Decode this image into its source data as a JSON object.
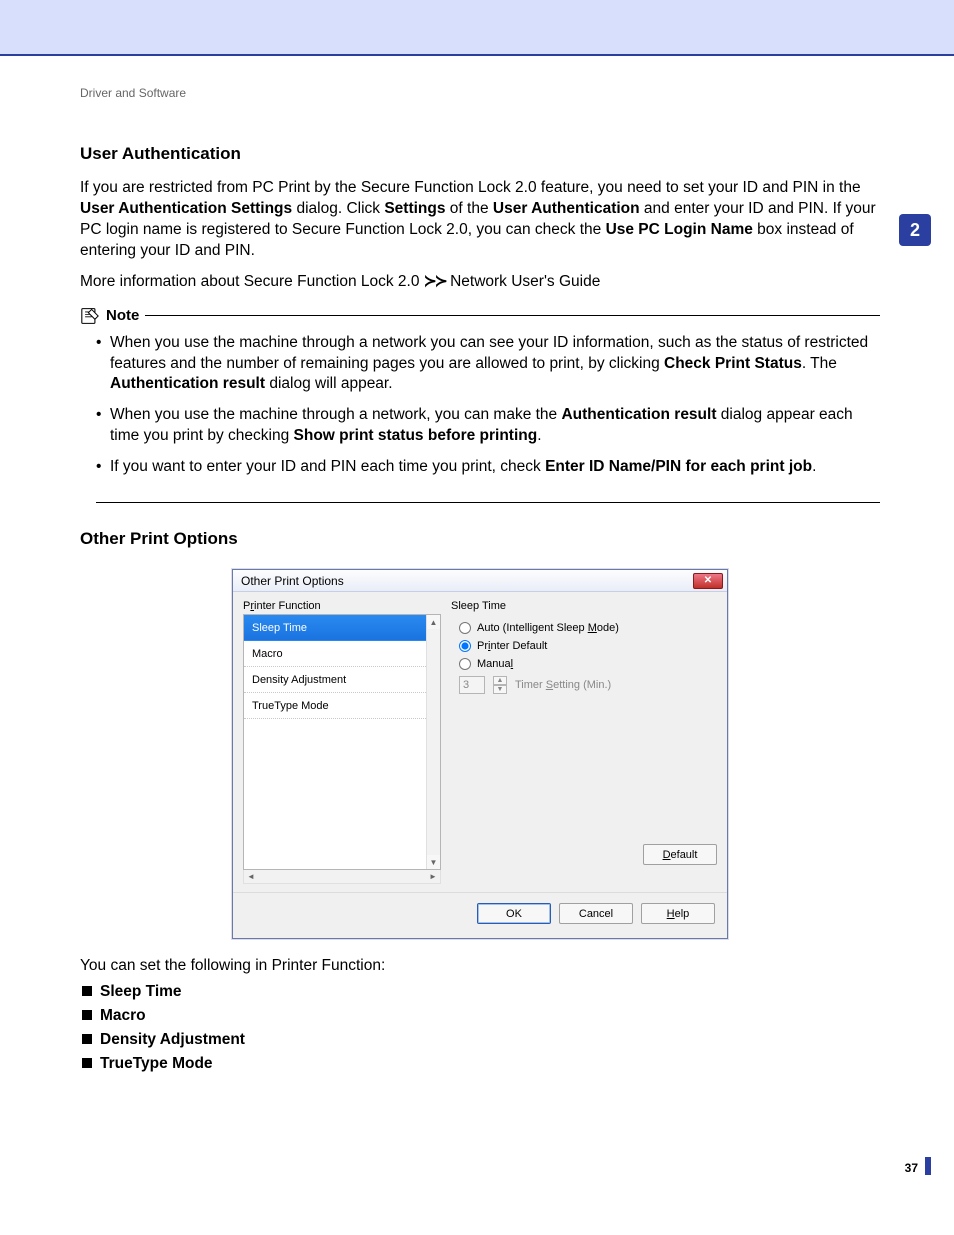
{
  "chapterTab": "2",
  "pageNumber": "37",
  "breadcrumb": "Driver and Software",
  "section1": {
    "heading": "User Authentication",
    "para1_a": "If you are restricted from PC Print by the Secure Function Lock 2.0 feature, you need to set your ID and PIN in the ",
    "para1_b": "User Authentication Settings",
    "para1_c": " dialog. Click ",
    "para1_d": "Settings",
    "para1_e": " of the ",
    "para1_f": "User Authentication",
    "para1_g": " and enter your ID and PIN. If your PC login name is registered to Secure Function Lock 2.0, you can check the ",
    "para1_h": "Use PC Login Name",
    "para1_i": " box instead of entering your ID and PIN.",
    "para2_a": "More information about Secure Function Lock 2.0 ",
    "para2_b": " Network User's Guide"
  },
  "note": {
    "label": "Note",
    "items": [
      {
        "a": "When you use the machine through a network you can see your ID information, such as the status of restricted features and the number of remaining pages you are allowed to print, by clicking ",
        "b": "Check Print Status",
        "c": ". The ",
        "d": "Authentication result",
        "e": " dialog will appear."
      },
      {
        "a": "When you use the machine through a network, you can make the ",
        "b": "Authentication result",
        "c": " dialog appear each time you print by checking ",
        "d": "Show print status before printing",
        "e": "."
      },
      {
        "a": "If you want to enter your ID and PIN each time you print, check ",
        "b": "Enter ID Name/PIN for each print job",
        "c": "."
      }
    ]
  },
  "section2": {
    "heading": "Other Print Options",
    "infoline": "You can set the following in Printer Function:",
    "funcs": [
      "Sleep Time",
      "Macro",
      "Density Adjustment",
      "TrueType Mode"
    ]
  },
  "dialog": {
    "title": "Other Print Options",
    "groupLabel_pre": "P",
    "groupLabel_ul": "r",
    "groupLabel_post": "inter Function",
    "listItems": [
      "Sleep Time",
      "Macro",
      "Density Adjustment",
      "TrueType Mode"
    ],
    "right": {
      "heading": "Sleep Time",
      "opt1_pre": "Auto (Intelligent Sleep ",
      "opt1_ul": "M",
      "opt1_post": "ode)",
      "opt2_pre": "Pr",
      "opt2_ul": "i",
      "opt2_post": "nter Default",
      "opt3_pre": "Manua",
      "opt3_ul": "l",
      "opt3_post": "",
      "spinValue": "3",
      "spinLabel_pre": "Timer ",
      "spinLabel_ul": "S",
      "spinLabel_post": "etting (Min.)",
      "defaultBtn_ul": "D",
      "defaultBtn_post": "efault"
    },
    "footer": {
      "ok": "OK",
      "cancel": "Cancel",
      "help_ul": "H",
      "help_post": "elp"
    }
  }
}
